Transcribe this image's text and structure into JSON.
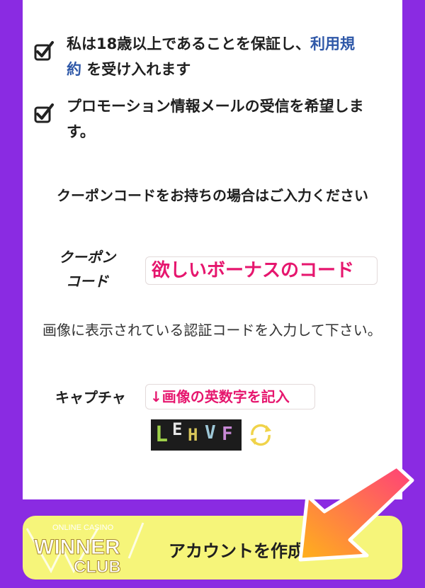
{
  "agreements": {
    "age_text": "私は18歳以上であることを保証し、",
    "age_link": "利用規約",
    "age_suffix": "を受け入れます",
    "promo_text": "プロモーション情報メールの受信を希望します。"
  },
  "coupon": {
    "hint": "クーポンコードをお持ちの場合はご入力ください",
    "label_line1": "クーポン",
    "label_line2": "コード",
    "value": "欲しいボーナスのコード"
  },
  "captcha": {
    "hint": "画像に表示されている認証コードを入力して下さい。",
    "label": "キャプチャ",
    "value": "↓画像の英数字を記入",
    "chars": [
      "L",
      "E",
      "H",
      "V",
      "F"
    ]
  },
  "submit": {
    "label": "アカウントを作成"
  },
  "logo": {
    "line1": "ONLINE CASINO",
    "line2": "WINNER",
    "line3": "CLUB"
  },
  "colors": {
    "background": "#8a2be2",
    "accent": "#e6166e",
    "link": "#2f58a8",
    "button": "#f6f57a",
    "arrow": "#ff8a1f"
  }
}
